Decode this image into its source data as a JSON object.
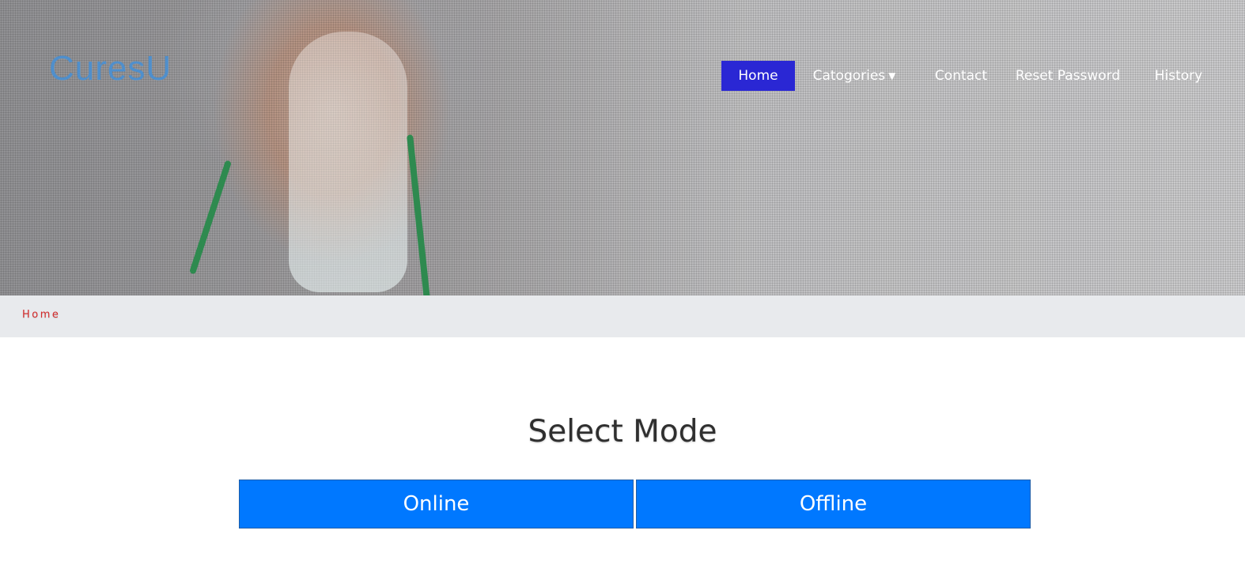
{
  "brand": {
    "logo_text": "CuresU",
    "logo_color": "#4f8fcc"
  },
  "nav": {
    "items": [
      {
        "label": "Home",
        "active": true
      },
      {
        "label": "Catogories",
        "has_dropdown": true
      },
      {
        "label": "Contact"
      },
      {
        "label": "Reset Password"
      },
      {
        "label": "History"
      }
    ],
    "active_color": "#2a27d4"
  },
  "breadcrumb": {
    "current": "Home",
    "color": "#d42a2a"
  },
  "main": {
    "title": "Select Mode",
    "buttons": {
      "online": "Online",
      "offline": "Offline"
    },
    "button_color": "#0078ff"
  }
}
